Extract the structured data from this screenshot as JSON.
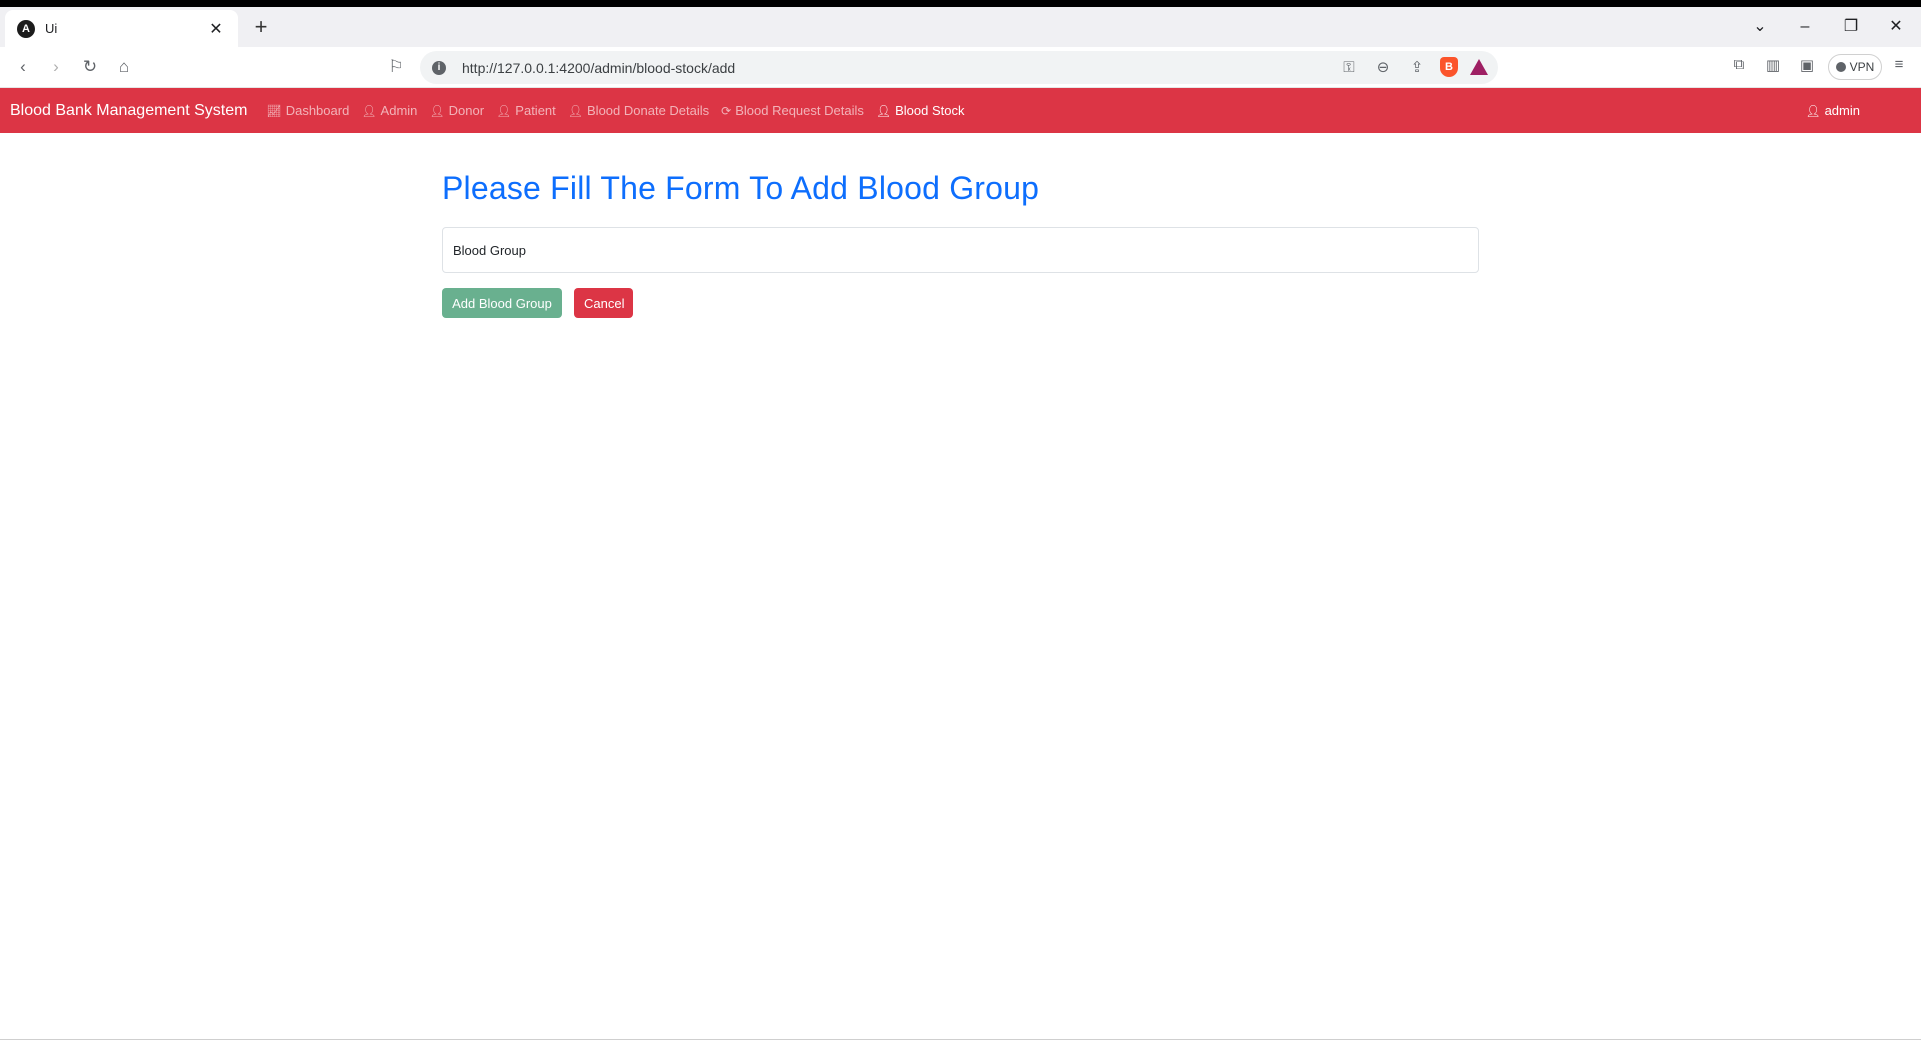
{
  "browser": {
    "tab_title": "Ui",
    "tab_favicon": "angular-icon",
    "url": "http://127.0.0.1:4200/admin/blood-stock/add",
    "vpn_label": "VPN"
  },
  "app": {
    "brand": "Blood Bank Management System",
    "nav": [
      {
        "label": "Dashboard",
        "icon": "chart-line-icon",
        "active": false
      },
      {
        "label": "Admin",
        "icon": "user-icon",
        "active": false
      },
      {
        "label": "Donor",
        "icon": "user-icon",
        "active": false
      },
      {
        "label": "Patient",
        "icon": "user-icon",
        "active": false
      },
      {
        "label": "Blood Donate Details",
        "icon": "user-hand-icon",
        "active": false
      },
      {
        "label": "Blood Request Details",
        "icon": "refresh-icon",
        "active": false
      },
      {
        "label": "Blood Stock",
        "icon": "user-hand-icon",
        "active": true
      }
    ],
    "user": "admin",
    "accent_color": "#dc3545"
  },
  "form": {
    "heading": "Please Fill The Form To Add Blood Group",
    "blood_group_placeholder": "Blood Group",
    "blood_group_value": "",
    "add_label": "Add Blood Group",
    "cancel_label": "Cancel"
  }
}
